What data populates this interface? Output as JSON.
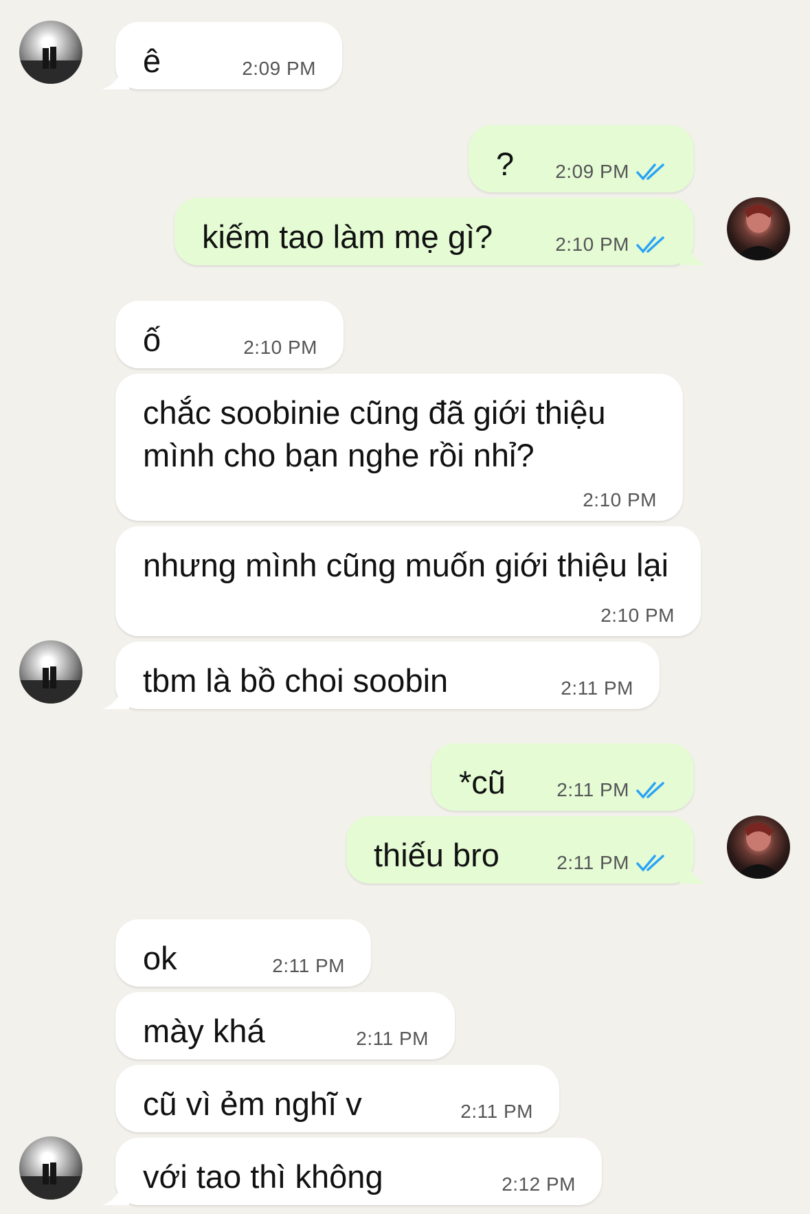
{
  "messages": [
    {
      "side": "in",
      "text": "ê",
      "time": "2:09 PM"
    },
    {
      "side": "out",
      "text": "?",
      "time": "2:09 PM"
    },
    {
      "side": "out",
      "text": "kiếm tao làm mẹ gì?",
      "time": "2:10 PM"
    },
    {
      "side": "in",
      "text": "ố",
      "time": "2:10 PM"
    },
    {
      "side": "in",
      "text": "chắc soobinie cũng đã giới thiệu mình cho bạn nghe rồi nhỉ?",
      "time": "2:10 PM"
    },
    {
      "side": "in",
      "text": "nhưng mình cũng muốn giới thiệu lại",
      "time": "2:10 PM"
    },
    {
      "side": "in",
      "text": "tbm là bồ choi soobin",
      "time": "2:11 PM"
    },
    {
      "side": "out",
      "text": "*cũ",
      "time": "2:11 PM"
    },
    {
      "side": "out",
      "text": "thiếu bro",
      "time": "2:11 PM"
    },
    {
      "side": "in",
      "text": "ok",
      "time": "2:11 PM"
    },
    {
      "side": "in",
      "text": "mày khá",
      "time": "2:11 PM"
    },
    {
      "side": "in",
      "text": "cũ vì ẻm nghĩ v",
      "time": "2:11 PM"
    },
    {
      "side": "in",
      "text": "với tao thì không",
      "time": "2:12 PM"
    }
  ],
  "colors": {
    "background": "#f3f1ec",
    "incoming_bubble": "#ffffff",
    "outgoing_bubble": "#e4fbd4",
    "read_ticks": "#2aa3f5"
  },
  "icons": {
    "read_receipt": "double-check-icon",
    "contact_avatar": "avatar-them",
    "own_avatar": "avatar-me"
  }
}
